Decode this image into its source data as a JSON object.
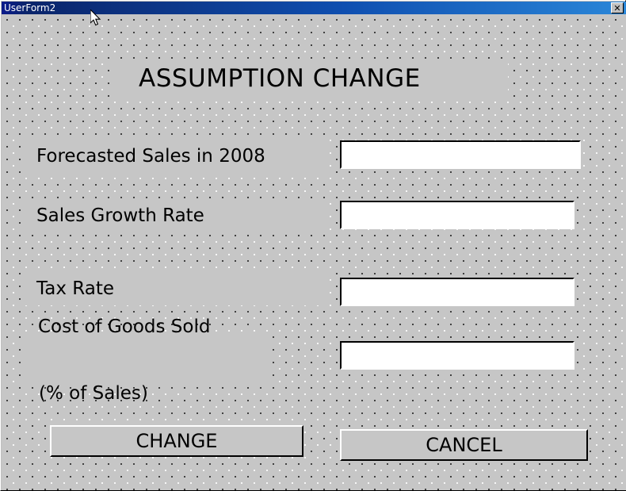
{
  "window": {
    "title": "UserForm2",
    "close_label": "✕"
  },
  "form": {
    "heading": "ASSUMPTION CHANGE",
    "fields": [
      {
        "label": "Forecasted Sales in 2008",
        "value": "",
        "placeholder": ""
      },
      {
        "label": "Sales Growth Rate",
        "value": "",
        "placeholder": ""
      },
      {
        "label": "Tax Rate",
        "value": "",
        "placeholder": ""
      },
      {
        "label_line1": "Cost of Goods Sold",
        "label_line2": "(% of Sales)",
        "value": "",
        "placeholder": ""
      }
    ],
    "buttons": {
      "change": "CHANGE",
      "cancel": "CANCEL"
    }
  },
  "colors": {
    "form_face": "#c6c6c6",
    "button_face": "#c0c0c0",
    "titlebar_start": "#0a246a",
    "titlebar_end": "#2a86d8",
    "titlebar_text": "#ffffff",
    "textbox_bg": "#ffffff",
    "text": "#000000"
  }
}
